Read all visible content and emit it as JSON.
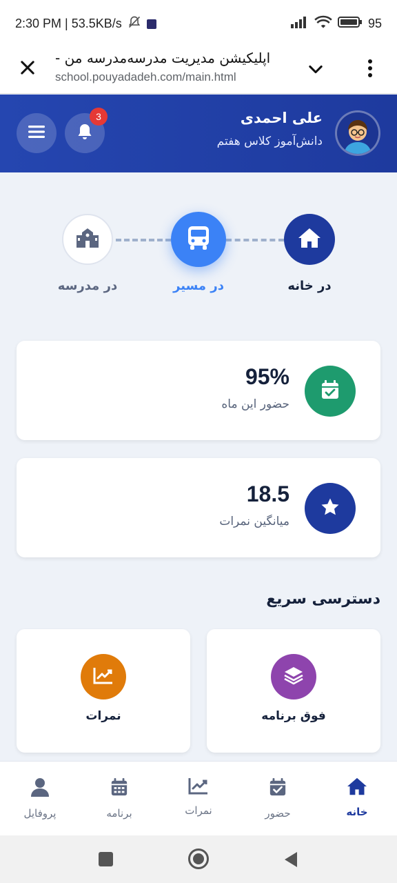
{
  "status_bar": {
    "time_and_speed": "2:30 PM | 53.5KB/s",
    "battery": "95"
  },
  "browser": {
    "title": "اپلیکیشن مدیریت مدرسه‌مدرسه من -",
    "url": "school.pouyadadeh.com/main.html"
  },
  "header": {
    "user_name": "علی احمدی",
    "user_role": "دانش‌آموز کلاس هفتم",
    "notification_count": "3"
  },
  "tracker": {
    "steps": [
      {
        "label": "در خانه",
        "icon": "home-icon",
        "state": "done"
      },
      {
        "label": "در مسیر",
        "icon": "bus-icon",
        "state": "active"
      },
      {
        "label": "در مدرسه",
        "icon": "school-icon",
        "state": "pending"
      }
    ]
  },
  "stats": [
    {
      "value": "95%",
      "label": "حضور این ماه",
      "icon": "calendar-check-icon",
      "color": "#1e9b6e"
    },
    {
      "value": "18.5",
      "label": "میانگین نمرات",
      "icon": "star-icon",
      "color": "#1e3a9e"
    }
  ],
  "quick_access": {
    "title": "دسترسی سریع",
    "items": [
      {
        "label": "فوق برنامه",
        "icon": "layers-icon",
        "color": "#8e44ad"
      },
      {
        "label": "نمرات",
        "icon": "chart-line-icon",
        "color": "#e07b0a"
      }
    ]
  },
  "bottom_nav": {
    "items": [
      {
        "label": "خانه",
        "icon": "home-icon",
        "active": true
      },
      {
        "label": "حضور",
        "icon": "calendar-check-icon"
      },
      {
        "label": "نمرات",
        "icon": "chart-line-icon"
      },
      {
        "label": "برنامه",
        "icon": "calendar-icon"
      },
      {
        "label": "پروفایل",
        "icon": "user-icon"
      }
    ]
  },
  "colors": {
    "primary": "#1e3a9e",
    "accent_blue": "#3b82f6",
    "green": "#1e9b6e",
    "purple": "#8e44ad",
    "orange": "#e07b0a",
    "badge_red": "#e53935"
  }
}
